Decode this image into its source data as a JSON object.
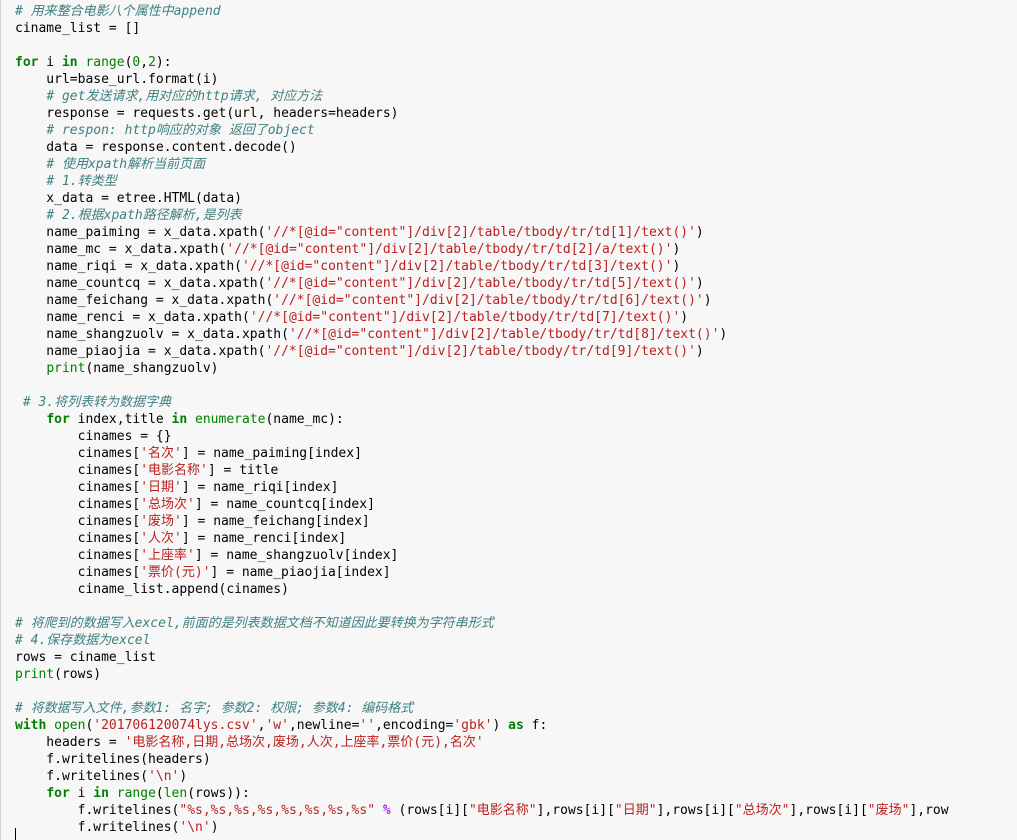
{
  "lines": [
    [
      [
        "cm",
        "# 用来整合电影八个属性中append"
      ]
    ],
    [
      [
        "tx",
        "ciname_list = []"
      ]
    ],
    [],
    [
      [
        "kw",
        "for"
      ],
      [
        "tx",
        " i "
      ],
      [
        "kw",
        "in"
      ],
      [
        "tx",
        " "
      ],
      [
        "bi",
        "range"
      ],
      [
        "tx",
        "("
      ],
      [
        "nu",
        "0"
      ],
      [
        "tx",
        ","
      ],
      [
        "nu",
        "2"
      ],
      [
        "tx",
        "):"
      ]
    ],
    [
      [
        "tx",
        "    url=base_url.format(i)"
      ]
    ],
    [
      [
        "tx",
        "    "
      ],
      [
        "cm",
        "# get发送请求,用对应的http请求, 对应方法"
      ]
    ],
    [
      [
        "tx",
        "    response = requests.get(url, headers=headers)"
      ]
    ],
    [
      [
        "tx",
        "    "
      ],
      [
        "cm",
        "# respon: http响应的对象 返回了object"
      ]
    ],
    [
      [
        "tx",
        "    data = response.content.decode()"
      ]
    ],
    [
      [
        "tx",
        "    "
      ],
      [
        "cm",
        "# 使用xpath解析当前页面"
      ]
    ],
    [
      [
        "tx",
        "    "
      ],
      [
        "cm",
        "# 1.转类型"
      ]
    ],
    [
      [
        "tx",
        "    x_data = etree.HTML(data)"
      ]
    ],
    [
      [
        "tx",
        "    "
      ],
      [
        "cm",
        "# 2.根据xpath路径解析,是列表"
      ]
    ],
    [
      [
        "tx",
        "    name_paiming = x_data.xpath("
      ],
      [
        "st",
        "'//*[@id=\"content\"]/div[2]/table/tbody/tr/td[1]/text()'"
      ],
      [
        "tx",
        ")"
      ]
    ],
    [
      [
        "tx",
        "    name_mc = x_data.xpath("
      ],
      [
        "st",
        "'//*[@id=\"content\"]/div[2]/table/tbody/tr/td[2]/a/text()'"
      ],
      [
        "tx",
        ")"
      ]
    ],
    [
      [
        "tx",
        "    name_riqi = x_data.xpath("
      ],
      [
        "st",
        "'//*[@id=\"content\"]/div[2]/table/tbody/tr/td[3]/text()'"
      ],
      [
        "tx",
        ")"
      ]
    ],
    [
      [
        "tx",
        "    name_countcq = x_data.xpath("
      ],
      [
        "st",
        "'//*[@id=\"content\"]/div[2]/table/tbody/tr/td[5]/text()'"
      ],
      [
        "tx",
        ")"
      ]
    ],
    [
      [
        "tx",
        "    name_feichang = x_data.xpath("
      ],
      [
        "st",
        "'//*[@id=\"content\"]/div[2]/table/tbody/tr/td[6]/text()'"
      ],
      [
        "tx",
        ")"
      ]
    ],
    [
      [
        "tx",
        "    name_renci = x_data.xpath("
      ],
      [
        "st",
        "'//*[@id=\"content\"]/div[2]/table/tbody/tr/td[7]/text()'"
      ],
      [
        "tx",
        ")"
      ]
    ],
    [
      [
        "tx",
        "    name_shangzuolv = x_data.xpath("
      ],
      [
        "st",
        "'//*[@id=\"content\"]/div[2]/table/tbody/tr/td[8]/text()'"
      ],
      [
        "tx",
        ")"
      ]
    ],
    [
      [
        "tx",
        "    name_piaojia = x_data.xpath("
      ],
      [
        "st",
        "'//*[@id=\"content\"]/div[2]/table/tbody/tr/td[9]/text()'"
      ],
      [
        "tx",
        ")"
      ]
    ],
    [
      [
        "tx",
        "    "
      ],
      [
        "bi",
        "print"
      ],
      [
        "tx",
        "(name_shangzuolv)"
      ]
    ],
    [],
    [
      [
        "tx",
        " "
      ],
      [
        "cm",
        "# 3.将列表转为数据字典"
      ]
    ],
    [
      [
        "tx",
        "    "
      ],
      [
        "kw",
        "for"
      ],
      [
        "tx",
        " index,title "
      ],
      [
        "kw",
        "in"
      ],
      [
        "tx",
        " "
      ],
      [
        "bi",
        "enumerate"
      ],
      [
        "tx",
        "(name_mc):"
      ]
    ],
    [
      [
        "tx",
        "        cinames = {}"
      ]
    ],
    [
      [
        "tx",
        "        cinames["
      ],
      [
        "st",
        "'名次'"
      ],
      [
        "tx",
        "] = name_paiming[index]"
      ]
    ],
    [
      [
        "tx",
        "        cinames["
      ],
      [
        "st",
        "'电影名称'"
      ],
      [
        "tx",
        "] = title"
      ]
    ],
    [
      [
        "tx",
        "        cinames["
      ],
      [
        "st",
        "'日期'"
      ],
      [
        "tx",
        "] = name_riqi[index]"
      ]
    ],
    [
      [
        "tx",
        "        cinames["
      ],
      [
        "st",
        "'总场次'"
      ],
      [
        "tx",
        "] = name_countcq[index]"
      ]
    ],
    [
      [
        "tx",
        "        cinames["
      ],
      [
        "st",
        "'废场'"
      ],
      [
        "tx",
        "] = name_feichang[index]"
      ]
    ],
    [
      [
        "tx",
        "        cinames["
      ],
      [
        "st",
        "'人次'"
      ],
      [
        "tx",
        "] = name_renci[index]"
      ]
    ],
    [
      [
        "tx",
        "        cinames["
      ],
      [
        "st",
        "'上座率'"
      ],
      [
        "tx",
        "] = name_shangzuolv[index]"
      ]
    ],
    [
      [
        "tx",
        "        cinames["
      ],
      [
        "st",
        "'票价(元)'"
      ],
      [
        "tx",
        "] = name_piaojia[index]"
      ]
    ],
    [
      [
        "tx",
        "        ciname_list.append(cinames)"
      ]
    ],
    [],
    [
      [
        "cm",
        "# 将爬到的数据写入excel,前面的是列表数据文档不知道因此要转换为字符串形式"
      ]
    ],
    [
      [
        "cm",
        "# 4.保存数据为excel"
      ]
    ],
    [
      [
        "tx",
        "rows = ciname_list"
      ]
    ],
    [
      [
        "bi",
        "print"
      ],
      [
        "tx",
        "(rows)"
      ]
    ],
    [],
    [
      [
        "cm",
        "# 将数据写入文件,参数1: 名字; 参数2: 权限; 参数4: 编码格式"
      ]
    ],
    [
      [
        "kw",
        "with"
      ],
      [
        "tx",
        " "
      ],
      [
        "bi",
        "open"
      ],
      [
        "tx",
        "("
      ],
      [
        "st",
        "'20170612007​4lys.csv'"
      ],
      [
        "tx",
        ","
      ],
      [
        "st",
        "'w'"
      ],
      [
        "tx",
        ",newline="
      ],
      [
        "st",
        "''"
      ],
      [
        "tx",
        ",encoding="
      ],
      [
        "st",
        "'gbk'"
      ],
      [
        "tx",
        ") "
      ],
      [
        "kw",
        "as"
      ],
      [
        "tx",
        " f:"
      ]
    ],
    [
      [
        "tx",
        "    headers = "
      ],
      [
        "st",
        "'电影名称,日期,总场次,废场,人次,上座率,票价(元),名次'"
      ]
    ],
    [
      [
        "tx",
        "    f.writelines(headers)"
      ]
    ],
    [
      [
        "tx",
        "    f.writelines("
      ],
      [
        "st",
        "'\\n'"
      ],
      [
        "tx",
        ")"
      ]
    ],
    [
      [
        "tx",
        "    "
      ],
      [
        "kw",
        "for"
      ],
      [
        "tx",
        " i "
      ],
      [
        "kw",
        "in"
      ],
      [
        "tx",
        " "
      ],
      [
        "bi",
        "range"
      ],
      [
        "tx",
        "("
      ],
      [
        "bi",
        "len"
      ],
      [
        "tx",
        "(rows)):"
      ]
    ],
    [
      [
        "tx",
        "        f.writelines("
      ],
      [
        "st",
        "\"%s,%s,%s,%s,%s,%s,%s,%s\""
      ],
      [
        "tx",
        " "
      ],
      [
        "op",
        "%"
      ],
      [
        "tx",
        " (rows[i]["
      ],
      [
        "st",
        "\"电影名称\""
      ],
      [
        "tx",
        "],rows[i]["
      ],
      [
        "st",
        "\"日期\""
      ],
      [
        "tx",
        "],rows[i]["
      ],
      [
        "st",
        "\"总场次\""
      ],
      [
        "tx",
        "],rows[i]["
      ],
      [
        "st",
        "\"废场\""
      ],
      [
        "tx",
        "],row"
      ]
    ],
    [
      [
        "tx",
        "        f.writelines("
      ],
      [
        "st",
        "'\\n'"
      ],
      [
        "tx",
        ")"
      ]
    ]
  ]
}
